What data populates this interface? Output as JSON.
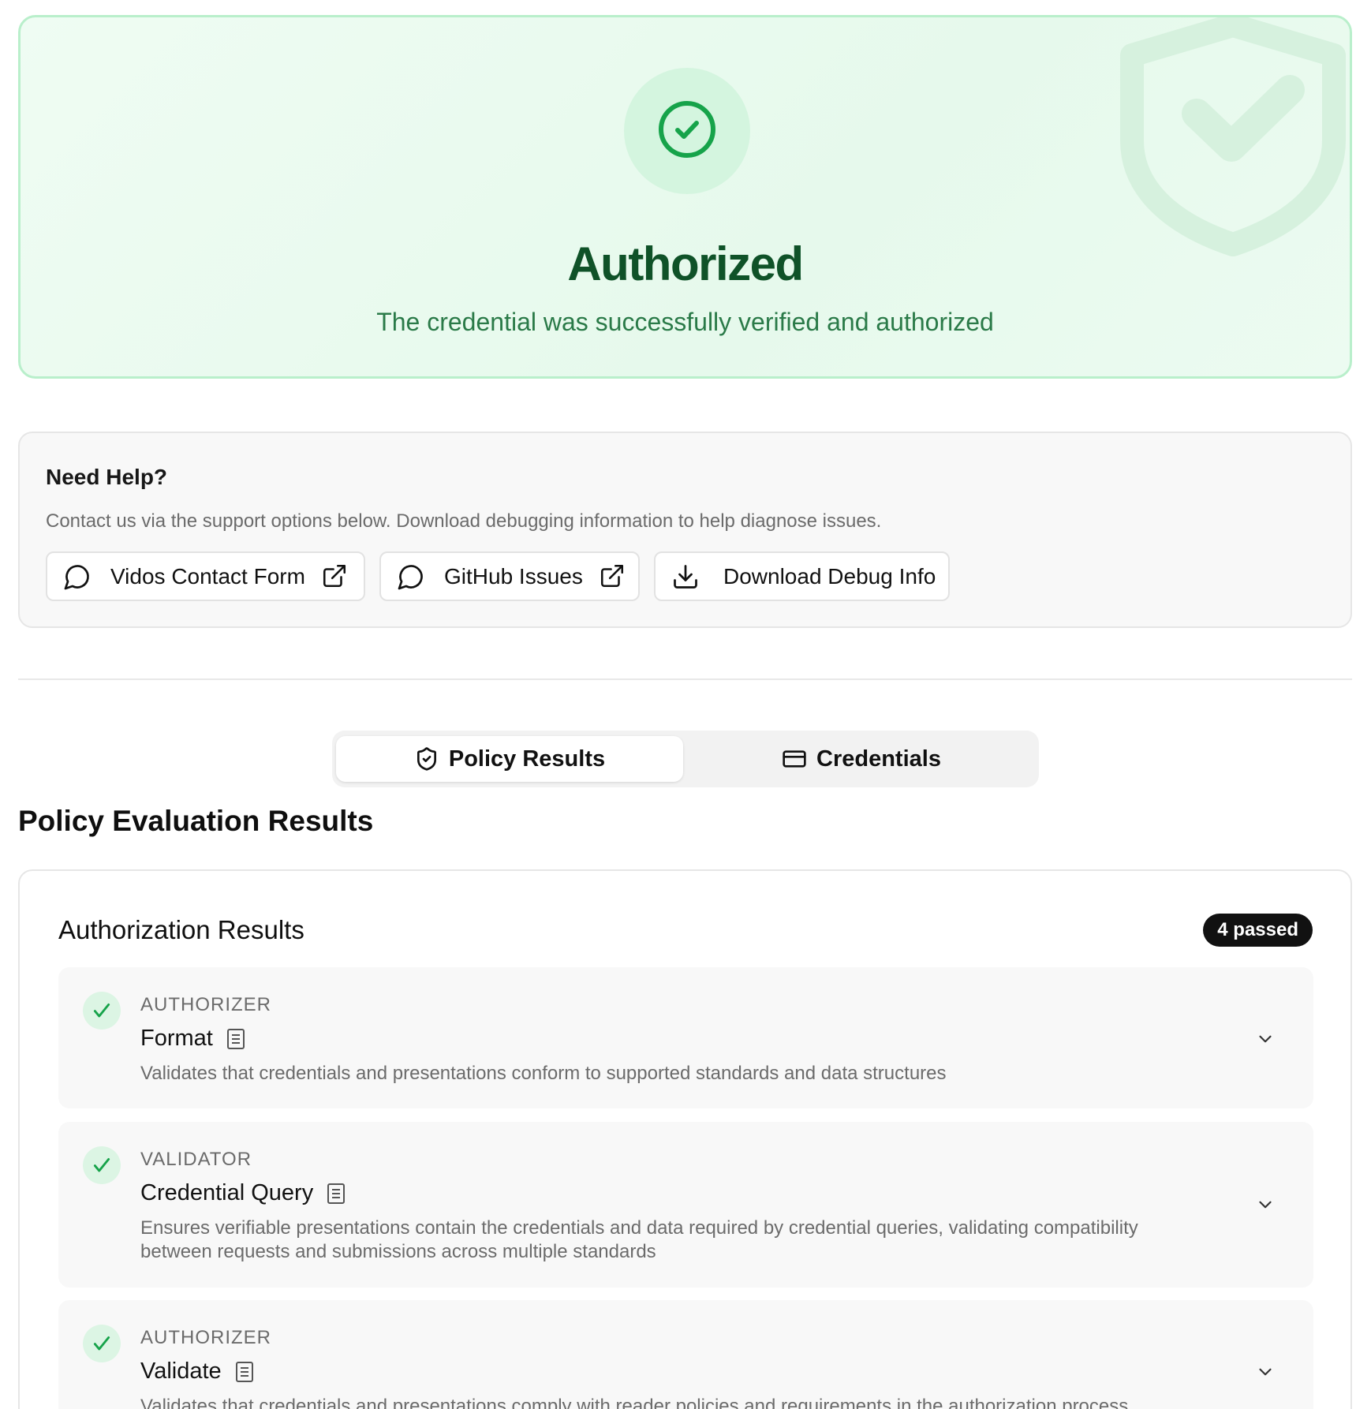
{
  "banner": {
    "title": "Authorized",
    "subtitle": "The credential was successfully verified and authorized",
    "accent_color": "#0f5228",
    "icon": "check-circle-icon",
    "watermark_icon": "shield-check-icon"
  },
  "help": {
    "title": "Need Help?",
    "description": "Contact us via the support options below. Download debugging information to help diagnose issues.",
    "buttons": [
      {
        "label": "Vidos Contact Form",
        "icon": "message-circle-icon",
        "trailing_icon": "external-link-icon"
      },
      {
        "label": "GitHub Issues",
        "icon": "message-circle-icon",
        "trailing_icon": "external-link-icon"
      },
      {
        "label": "Download Debug Info",
        "icon": "download-icon"
      }
    ]
  },
  "tabs": [
    {
      "label": "Policy Results",
      "icon": "shield-check-icon",
      "active": true
    },
    {
      "label": "Credentials",
      "icon": "credit-card-icon",
      "active": false
    }
  ],
  "section_title": "Policy Evaluation Results",
  "results": {
    "title": "Authorization Results",
    "badge": "4 passed",
    "items": [
      {
        "kind": "AUTHORIZER",
        "name": "Format",
        "description": "Validates that credentials and presentations conform to supported standards and data structures",
        "status": "passed"
      },
      {
        "kind": "VALIDATOR",
        "name": "Credential Query",
        "description": "Ensures verifiable presentations contain the credentials and data required by credential queries, validating compatibility between requests and submissions across multiple standards",
        "status": "passed"
      },
      {
        "kind": "AUTHORIZER",
        "name": "Validate",
        "description": "Validates that credentials and presentations comply with reader policies and requirements in the authorization process",
        "status": "passed"
      }
    ]
  },
  "colors": {
    "success": "#16a34a",
    "badge_bg": "#111111"
  }
}
